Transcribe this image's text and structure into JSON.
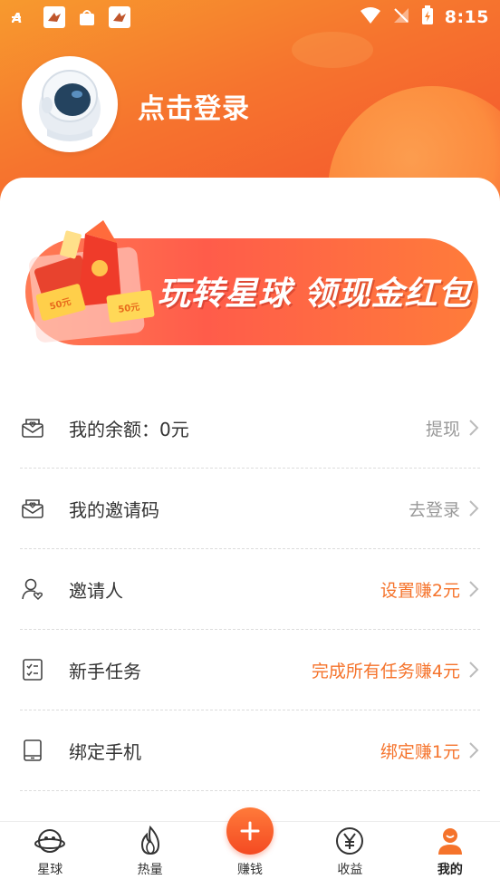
{
  "status_bar": {
    "time": "8:15",
    "left_icons": [
      "font-icon",
      "bird-icon",
      "bag-icon",
      "bird-icon"
    ],
    "right_icons": [
      "wifi-icon",
      "signal-off-icon",
      "battery-charging-icon"
    ]
  },
  "header": {
    "login_label": "点击登录",
    "avatar": "astronaut-avatar"
  },
  "banner": {
    "title": "玩转星球 领现金红包",
    "coupon_1": "50元",
    "coupon_2": "50元"
  },
  "list": [
    {
      "label": "我的余额：0元",
      "right": "提现",
      "right_color": "#999999",
      "icon": "envelope-heart-icon"
    },
    {
      "label": "我的邀请码",
      "right": "去登录",
      "right_color": "#999999",
      "icon": "envelope-heart-icon"
    },
    {
      "label": "邀请人",
      "right": "设置赚2元",
      "right_color": "#f5732b",
      "icon": "user-heart-icon"
    },
    {
      "label": "新手任务",
      "right": "完成所有任务赚4元",
      "right_color": "#f5732b",
      "icon": "checklist-icon"
    },
    {
      "label": "绑定手机",
      "right": "绑定赚1元",
      "right_color": "#f5732b",
      "icon": "tablet-icon"
    }
  ],
  "nav": [
    {
      "label": "星球",
      "icon": "planet-face-icon"
    },
    {
      "label": "热量",
      "icon": "flame-icon"
    },
    {
      "label": "赚钱",
      "icon": "plus-icon"
    },
    {
      "label": "收益",
      "icon": "yen-icon"
    },
    {
      "label": "我的",
      "icon": "profile-icon",
      "active": true
    }
  ],
  "colors": {
    "accent": "#f5732b",
    "header_gradient_start": "#f79a2e",
    "header_gradient_end": "#f4532d"
  }
}
